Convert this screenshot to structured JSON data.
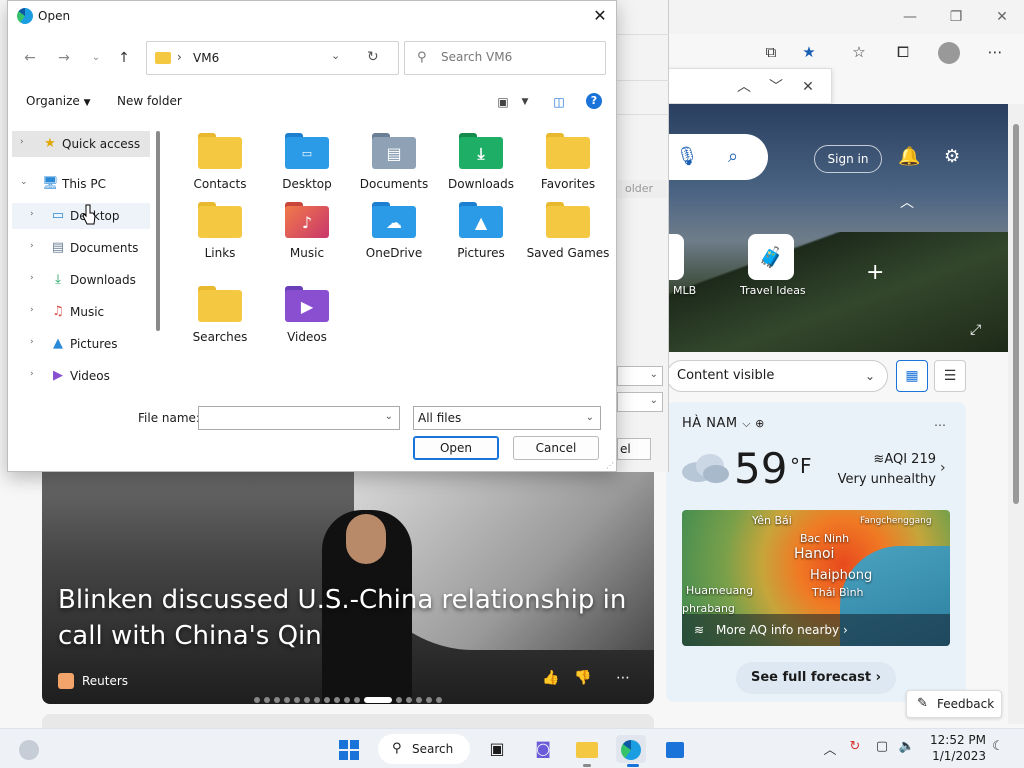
{
  "colors": {
    "accent": "#1a73d9",
    "folder_yellow": "#f5c842",
    "taskbar_bg": "#eef1f6"
  },
  "dialog": {
    "title": "Open",
    "address": {
      "path": "VM6",
      "separator": "›"
    },
    "search_placeholder": "Search VM6",
    "cmdbar": {
      "organize": "Organize",
      "new_folder": "New folder"
    },
    "nav": [
      {
        "label": "Quick access",
        "icon": "star-icon",
        "expanded": false
      },
      {
        "label": "This PC",
        "icon": "pc-icon",
        "expanded": true
      },
      {
        "label": "Desktop",
        "icon": "desktop-icon"
      },
      {
        "label": "Documents",
        "icon": "documents-icon"
      },
      {
        "label": "Downloads",
        "icon": "download-icon"
      },
      {
        "label": "Music",
        "icon": "music-icon"
      },
      {
        "label": "Pictures",
        "icon": "pictures-icon"
      },
      {
        "label": "Videos",
        "icon": "videos-icon"
      }
    ],
    "files": [
      {
        "name": "Contacts"
      },
      {
        "name": "Desktop"
      },
      {
        "name": "Documents"
      },
      {
        "name": "Downloads"
      },
      {
        "name": "Favorites"
      },
      {
        "name": "Links"
      },
      {
        "name": "Music"
      },
      {
        "name": "OneDrive"
      },
      {
        "name": "Pictures"
      },
      {
        "name": "Saved Games"
      },
      {
        "name": "Searches"
      },
      {
        "name": "Videos"
      }
    ],
    "file_name_label": "File name:",
    "file_name_value": "",
    "filter_value": "All files",
    "open_label": "Open",
    "cancel_label": "Cancel"
  },
  "browser": {
    "sign_in": "Sign in",
    "quick_links": [
      {
        "label": "MLB"
      },
      {
        "label": "Travel Ideas"
      }
    ],
    "content_select": "Content visible",
    "ghost": {
      "folder": "older",
      "btn": "el"
    },
    "weather": {
      "location": "HÀ NAM",
      "temperature": "59",
      "unit": "°F",
      "aqi": "AQI 219",
      "aqi_status": "Very unhealthy",
      "map_labels": {
        "yen_bai": "Yên Bái",
        "fangchenggang": "Fangchenggang",
        "bac_ninh": "Bac Ninh",
        "hanoi": "Hanoi",
        "haiphong": "Haiphong",
        "huameuang": "Huameuang",
        "thai_binh": "Thái Bình",
        "phrabang": "phrabang"
      },
      "more_aq": "More AQ info nearby ›",
      "forecast_btn": "See full forecast ›"
    },
    "news": {
      "title": "Blinken discussed U.S.-China relationship in call with China's Qin",
      "source": "Reuters"
    },
    "feedback": "Feedback"
  },
  "taskbar": {
    "search_label": "Search",
    "time": "12:52 PM",
    "date": "1/1/2023"
  }
}
